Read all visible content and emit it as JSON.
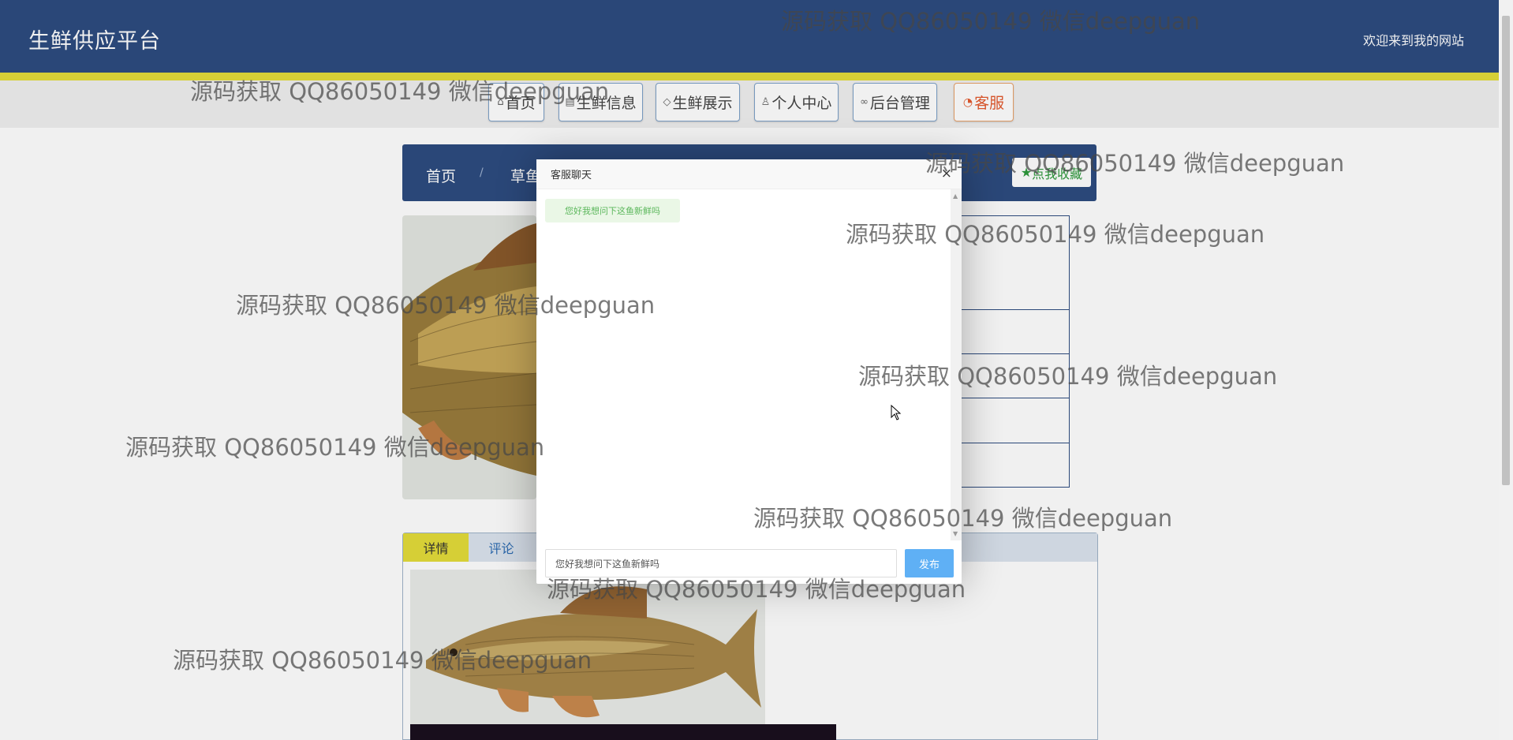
{
  "header": {
    "site_title": "生鲜供应平台",
    "welcome": "欢迎来到我的网站"
  },
  "nav": {
    "items": [
      {
        "label": "首页",
        "icon": "home-icon"
      },
      {
        "label": "生鲜信息",
        "icon": "list-icon"
      },
      {
        "label": "生鲜展示",
        "icon": "tag-icon"
      },
      {
        "label": "个人中心",
        "icon": "user-icon"
      },
      {
        "label": "后台管理",
        "icon": "link-icon"
      },
      {
        "label": "客服",
        "icon": "chat-icon"
      }
    ]
  },
  "breadcrumb": {
    "home": "首页",
    "separator": "/",
    "current": "草鱼"
  },
  "favorite": {
    "label": "点我收藏",
    "icon": "star-icon"
  },
  "tabs": [
    {
      "label": "详情"
    },
    {
      "label": "评论"
    }
  ],
  "dialog": {
    "title": "客服聊天",
    "close": "×",
    "message": "您好我想问下这鱼新鲜吗",
    "input_value": "您好我想问下这鱼新鲜吗",
    "send_label": "发布"
  },
  "watermark": {
    "text": "源码获取 QQ86050149 微信deepguan"
  },
  "colors": {
    "header_bg": "#2d4c80",
    "accent_yellow": "#e4dc3a",
    "send_button": "#5fb0f5",
    "message_bubble": "#eaf7e6",
    "favorite_text": "#2e9a3c",
    "kefu_text": "#e45a2e"
  }
}
